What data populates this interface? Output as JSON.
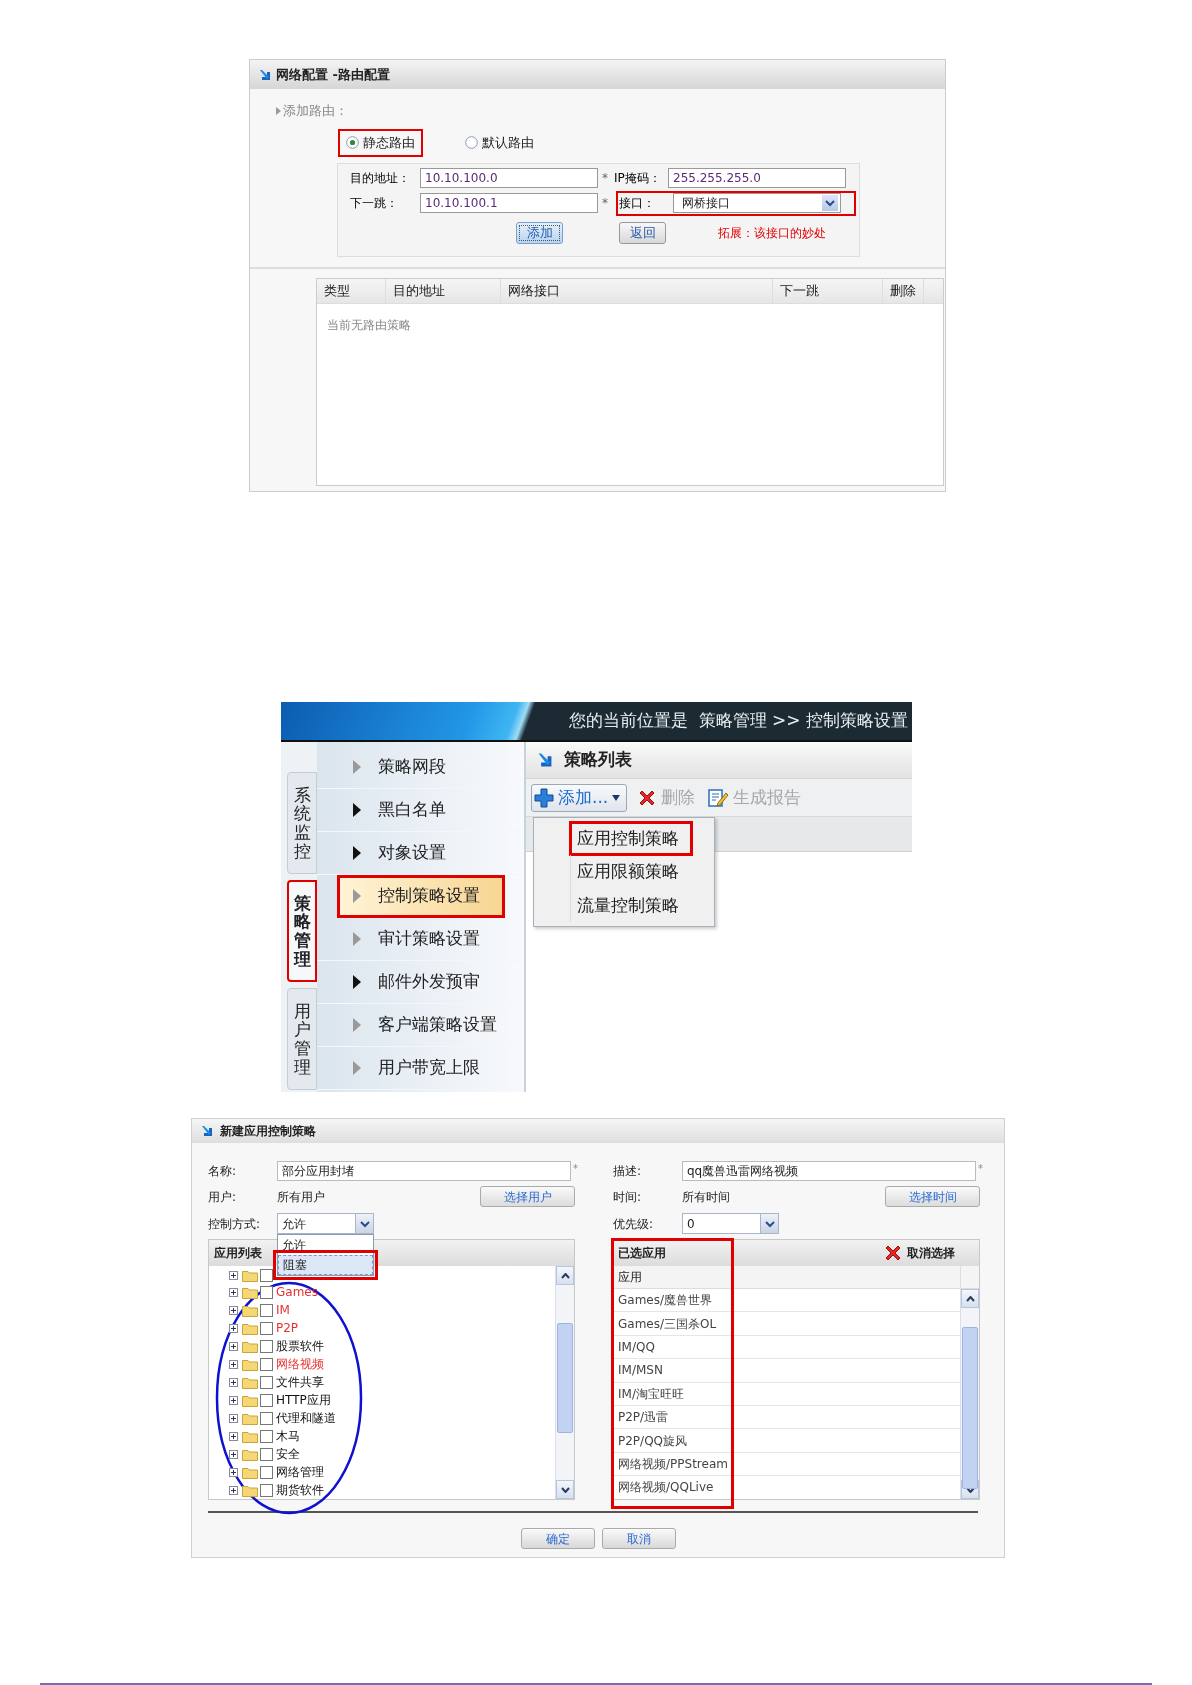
{
  "route_panel": {
    "title": "网络配置 -路由配置",
    "section": "添加路由：",
    "route_types": [
      {
        "label": "静态路由",
        "selected": true,
        "marked": true
      },
      {
        "label": "默认路由",
        "selected": false,
        "marked": false
      }
    ],
    "fields": [
      {
        "kind": "text",
        "label": "目的地址：",
        "value": "10.10.100.0",
        "suffix": "*",
        "marked": false
      },
      {
        "kind": "text",
        "label": "IP掩码：",
        "value": "255.255.255.0",
        "marked": false
      },
      {
        "kind": "text",
        "label": "下一跳：",
        "value": "10.10.100.1",
        "suffix": "*",
        "marked": false
      },
      {
        "kind": "select",
        "label": "接口：",
        "value": "网桥接口",
        "marked": true
      }
    ],
    "buttons": [
      {
        "label": "添加",
        "focused": true
      },
      {
        "label": "返回",
        "focused": false
      }
    ],
    "note": "拓展：该接口的妙处",
    "table": {
      "columns": [
        "类型",
        "目的地址",
        "网络接口",
        "下一跳",
        "删除"
      ],
      "empty_text": "当前无路由策略"
    }
  },
  "policy_panel": {
    "breadcrumb": "您的当前位置是  策略管理 >> 控制策略设置",
    "side_tabs": [
      {
        "label": "系统监控",
        "selected": false,
        "marked": false
      },
      {
        "label": "策略管理",
        "selected": true,
        "marked": true
      },
      {
        "label": "用户管理",
        "selected": false,
        "marked": false
      }
    ],
    "menu": [
      {
        "label": "策略网段",
        "selected": false,
        "marked": false,
        "emphasized": false
      },
      {
        "label": "黑白名单",
        "selected": false,
        "marked": false,
        "emphasized": true
      },
      {
        "label": "对象设置",
        "selected": false,
        "marked": false,
        "emphasized": true
      },
      {
        "label": "控制策略设置",
        "selected": true,
        "marked": true,
        "emphasized": false
      },
      {
        "label": "审计策略设置",
        "selected": false,
        "marked": false,
        "emphasized": false
      },
      {
        "label": "邮件外发预审",
        "selected": false,
        "marked": false,
        "emphasized": true
      },
      {
        "label": "客户端策略设置",
        "selected": false,
        "marked": false,
        "emphasized": false
      },
      {
        "label": "用户带宽上限",
        "selected": false,
        "marked": false,
        "emphasized": false
      }
    ],
    "title": "策略列表",
    "toolbar": [
      {
        "kind": "add",
        "label": "添加...",
        "disabled": false
      },
      {
        "kind": "delete",
        "label": "删除",
        "disabled": true
      },
      {
        "kind": "report",
        "label": "生成报告",
        "disabled": true
      }
    ],
    "dropdown": [
      {
        "label": "应用控制策略",
        "marked": true
      },
      {
        "label": "应用限额策略",
        "marked": false
      },
      {
        "label": "流量控制策略",
        "marked": false
      }
    ]
  },
  "app_policy_dialog": {
    "title": "新建应用控制策略",
    "name": {
      "label": "名称:",
      "value": "部分应用封堵",
      "suffix": "*"
    },
    "description": {
      "label": "描述:",
      "value": "qq魔兽迅雷网络视频",
      "suffix": "*"
    },
    "user": {
      "label": "用户:",
      "value": "所有用户",
      "button": "选择用户"
    },
    "time": {
      "label": "时间:",
      "value": "所有时间",
      "button": "选择时间"
    },
    "control_mode": {
      "label": "控制方式:",
      "value": "允许",
      "expanded": true,
      "options": [
        {
          "label": "允许",
          "highlighted": false,
          "marked": false
        },
        {
          "label": "阻塞",
          "highlighted": true,
          "marked": true
        }
      ]
    },
    "priority": {
      "label": "优先级:",
      "value": "0"
    },
    "app_list": {
      "title": "应用列表",
      "circled": true,
      "items": [
        {
          "label": "Games",
          "highlighted": true
        },
        {
          "label": "IM",
          "highlighted": true
        },
        {
          "label": "P2P",
          "highlighted": true
        },
        {
          "label": "股票软件",
          "highlighted": false
        },
        {
          "label": "网络视频",
          "highlighted": true
        },
        {
          "label": "文件共享",
          "highlighted": false
        },
        {
          "label": "HTTP应用",
          "highlighted": false
        },
        {
          "label": "代理和隧道",
          "highlighted": false
        },
        {
          "label": "木马",
          "highlighted": false
        },
        {
          "label": "安全",
          "highlighted": false
        },
        {
          "label": "网络管理",
          "highlighted": false
        },
        {
          "label": "期货软件",
          "highlighted": false
        }
      ]
    },
    "selected_apps": {
      "title": "已选应用",
      "clear_button": "取消选择",
      "column": "应用",
      "marked": true,
      "rows": [
        "Games/魔兽世界",
        "Games/三国杀OL",
        "IM/QQ",
        "IM/MSN",
        "IM/淘宝旺旺",
        "P2P/迅雷",
        "P2P/QQ旋风",
        "网络视频/PPStream",
        "网络视频/QQLive"
      ]
    },
    "buttons": [
      "确定",
      "取消"
    ]
  }
}
